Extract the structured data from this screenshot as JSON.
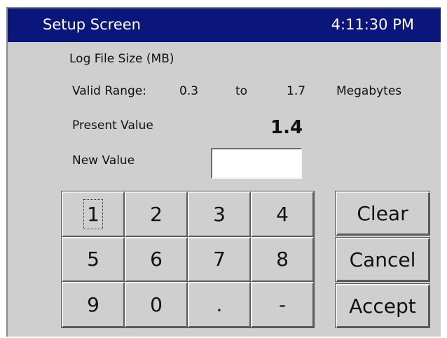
{
  "titlebar": {
    "title": "Setup Screen",
    "clock": "4:11:30 PM"
  },
  "setting": {
    "name": "Log File Size (MB)",
    "valid_range_label": "Valid Range:",
    "range_min": "0.3",
    "range_to": "to",
    "range_max": "1.7",
    "range_unit": "Megabytes",
    "present_label": "Present Value",
    "present_value": "1.4",
    "new_label": "New Value",
    "new_value": ""
  },
  "keypad": {
    "keys": [
      "1",
      "2",
      "3",
      "4",
      "5",
      "6",
      "7",
      "8",
      "9",
      "0",
      ".",
      "-"
    ]
  },
  "actions": {
    "clear": "Clear",
    "cancel": "Cancel",
    "accept": "Accept"
  },
  "colors": {
    "titlebar": "#0a167a",
    "panel": "#cfcfcf"
  }
}
